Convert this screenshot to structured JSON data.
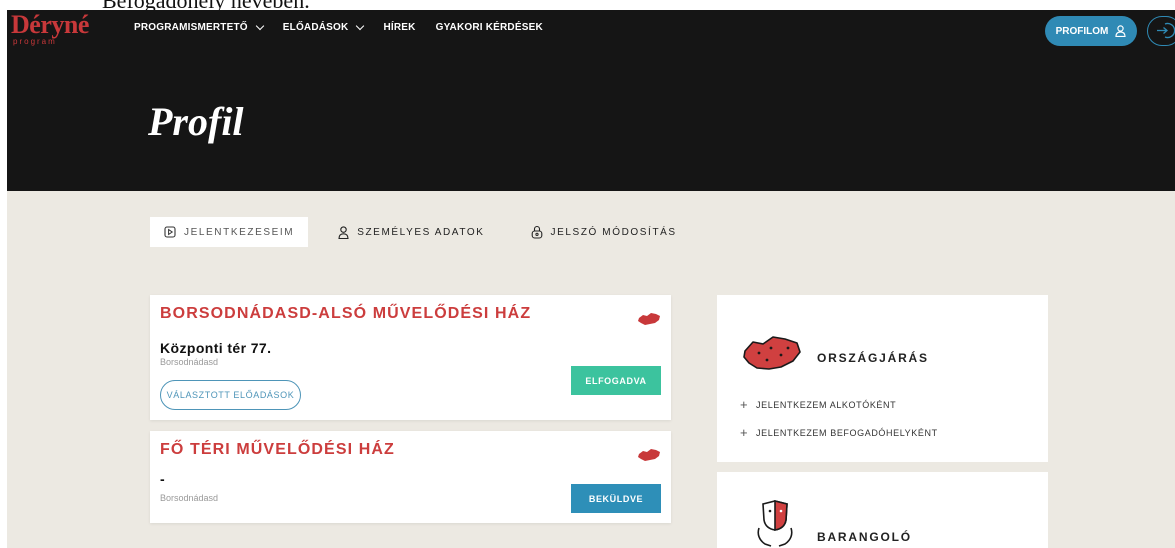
{
  "caption": "Befogadóhely nevében.",
  "header": {
    "logo_text": "Déryné",
    "logo_sub": "program",
    "nav": [
      {
        "label": "PROGRAMISMERTETŐ",
        "has_dropdown": true
      },
      {
        "label": "ELŐADÁSOK",
        "has_dropdown": true
      },
      {
        "label": "HÍREK",
        "has_dropdown": false
      },
      {
        "label": "GYAKORI KÉRDÉSEK",
        "has_dropdown": false
      }
    ],
    "profile_button": "PROFILOM",
    "icons": {
      "profile": "user-icon",
      "logout": "logout-icon"
    }
  },
  "page": {
    "title": "Profil"
  },
  "tabs": [
    {
      "label": "JELENTKEZESEIM",
      "icon": "play-square-icon",
      "active": true
    },
    {
      "label": "SZEMÉLYES ADATOK",
      "icon": "user-icon",
      "active": false
    },
    {
      "label": "JELSZÓ MÓDOSÍTÁS",
      "icon": "lock-icon",
      "active": false
    }
  ],
  "applications": [
    {
      "name": "BORSODNÁDASD-ALSÓ MŰVELŐDÉSI HÁZ",
      "address": "Központi tér 77.",
      "city": "Borsodnádasd",
      "button": "VÁLASZTOTT ELŐADÁSOK",
      "status": "ELFOGADVA",
      "status_color": "#3cc39e"
    },
    {
      "name": "FŐ TÉRI MŰVELŐDÉSI HÁZ",
      "address": "-",
      "city": "Borsodnádasd",
      "status": "BEKÜLDVE",
      "status_color": "#2e8fb8"
    }
  ],
  "sidebar": {
    "orszagjaras": {
      "title": "ORSZÁGJÁRÁS",
      "icon": "hungary-map-icon",
      "links": [
        "JELENTKEZEM ALKOTÓKÉNT",
        "JELENTKEZEM BEFOGADÓHELYKÉNT"
      ]
    },
    "barangolo": {
      "title": "BARANGOLÓ",
      "icon": "theater-masks-hands-icon"
    }
  },
  "colors": {
    "brand_red": "#c8383a",
    "accent_blue": "#2f8ab5",
    "header_bg": "#151515",
    "page_bg": "#ece9e2"
  }
}
